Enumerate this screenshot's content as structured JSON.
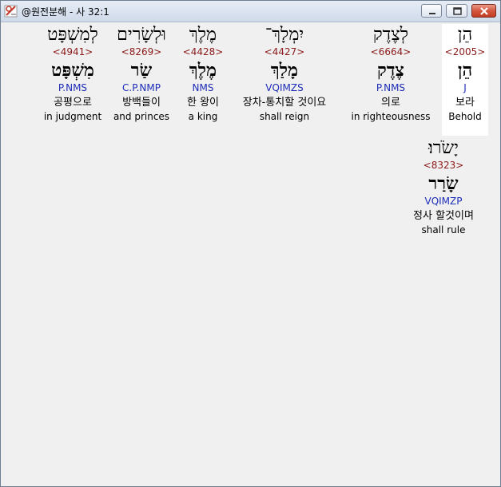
{
  "window": {
    "title": "@원전분해 - 사 32:1"
  },
  "rows": [
    [
      {
        "hebrew": "הֵן",
        "strong": "<2005>",
        "lemma": "הֵן",
        "parse": "J",
        "korean": "보라",
        "english": "Behold"
      },
      {
        "hebrew": "לְצֶדֶק",
        "strong": "<6664>",
        "lemma": "צֶדֶק",
        "parse": "P.NMS",
        "korean": "의로",
        "english": "in righteousness"
      },
      {
        "hebrew": "יִמְלָךְ־",
        "strong": "<4427>",
        "lemma": "מָלַךְ",
        "parse": "VQIMZS",
        "korean": "장차-통치할 것이요",
        "english": "shall reign"
      },
      {
        "hebrew": "מֶלֶךְ",
        "strong": "<4428>",
        "lemma": "מֶלֶךְ",
        "parse": "NMS",
        "korean": "한 왕이",
        "english": "a king"
      },
      {
        "hebrew": "וּלְשָׂרִים",
        "strong": "<8269>",
        "lemma": "שַׂר",
        "parse": "C.P.NMP",
        "korean": "방백들이",
        "english": "and princes"
      },
      {
        "hebrew": "לְמִשְׁפָּט",
        "strong": "<4941>",
        "lemma": "מִשְׁפָּט",
        "parse": "P.NMS",
        "korean": "공평으로",
        "english": "in judgment"
      }
    ],
    [
      {
        "hebrew": "יָשֹׂרוּ׃",
        "strong": "<8323>",
        "lemma": "שָׂרַר",
        "parse": "VQIMZP",
        "korean": "정사 할것이며",
        "english": "shall rule"
      }
    ]
  ]
}
